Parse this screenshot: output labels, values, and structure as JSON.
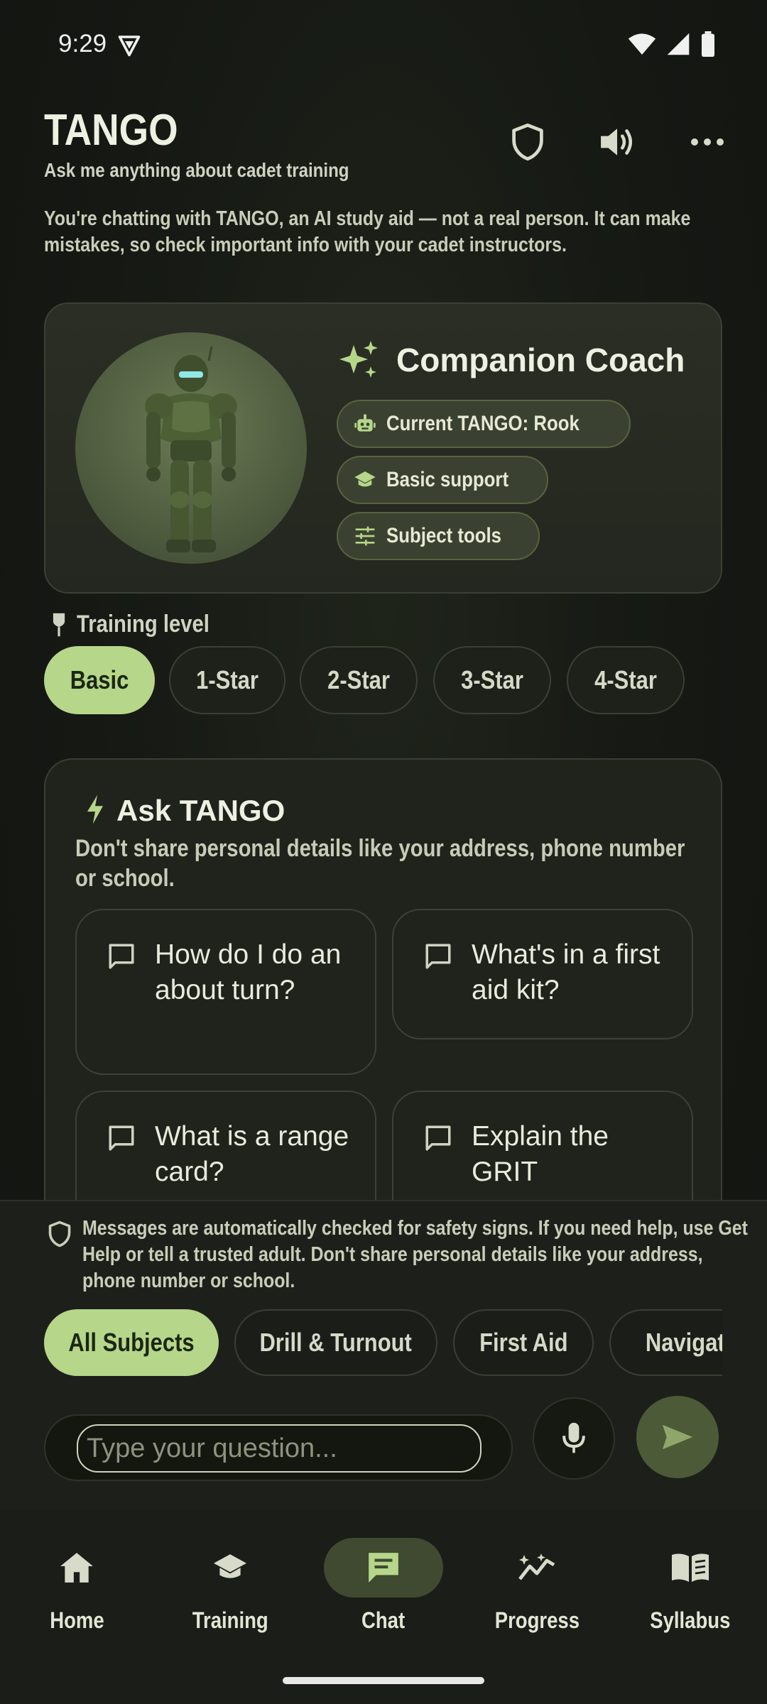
{
  "status_bar": {
    "time": "9:29"
  },
  "header": {
    "title": "TANGO",
    "subtitle": "Ask me anything about cadet training",
    "disclaimer": "You're chatting with TANGO, an AI study aid — not a real person. It can make mistakes, so check important info with your cadet instructors."
  },
  "coach": {
    "title": "Companion Coach",
    "chips": [
      {
        "label": "Current TANGO: Rook",
        "icon": "robot-icon"
      },
      {
        "label": "Basic support",
        "icon": "graduation-cap-icon"
      },
      {
        "label": "Subject tools",
        "icon": "sliders-icon"
      }
    ]
  },
  "training_level": {
    "label": "Training level",
    "levels": [
      "Basic",
      "1-Star",
      "2-Star",
      "3-Star",
      "4-Star"
    ],
    "selected": "Basic"
  },
  "ask": {
    "title": "Ask TANGO",
    "warning": "Don't share personal details like your address, phone number or school.",
    "questions": [
      "How do I do an about turn?",
      "What's in a first aid kit?",
      "What is a range card?",
      "Explain the GRIT"
    ]
  },
  "safety": {
    "text": "Messages are automatically checked for safety signs. If you need help, use Get Help or tell a trusted adult. Don't share personal details like your address, phone number or school."
  },
  "subjects": {
    "items": [
      "All Subjects",
      "Drill & Turnout",
      "First Aid",
      "Navigation"
    ],
    "selected": "All Subjects"
  },
  "composer": {
    "placeholder": "Type your question..."
  },
  "nav": {
    "items": [
      {
        "label": "Home",
        "icon": "home-icon"
      },
      {
        "label": "Training",
        "icon": "training-icon"
      },
      {
        "label": "Chat",
        "icon": "chat-icon"
      },
      {
        "label": "Progress",
        "icon": "progress-icon"
      },
      {
        "label": "Syllabus",
        "icon": "book-icon"
      }
    ],
    "active": "Chat"
  },
  "colors": {
    "accent": "#b6d68a",
    "background": "#151813",
    "card": "#23271f"
  }
}
